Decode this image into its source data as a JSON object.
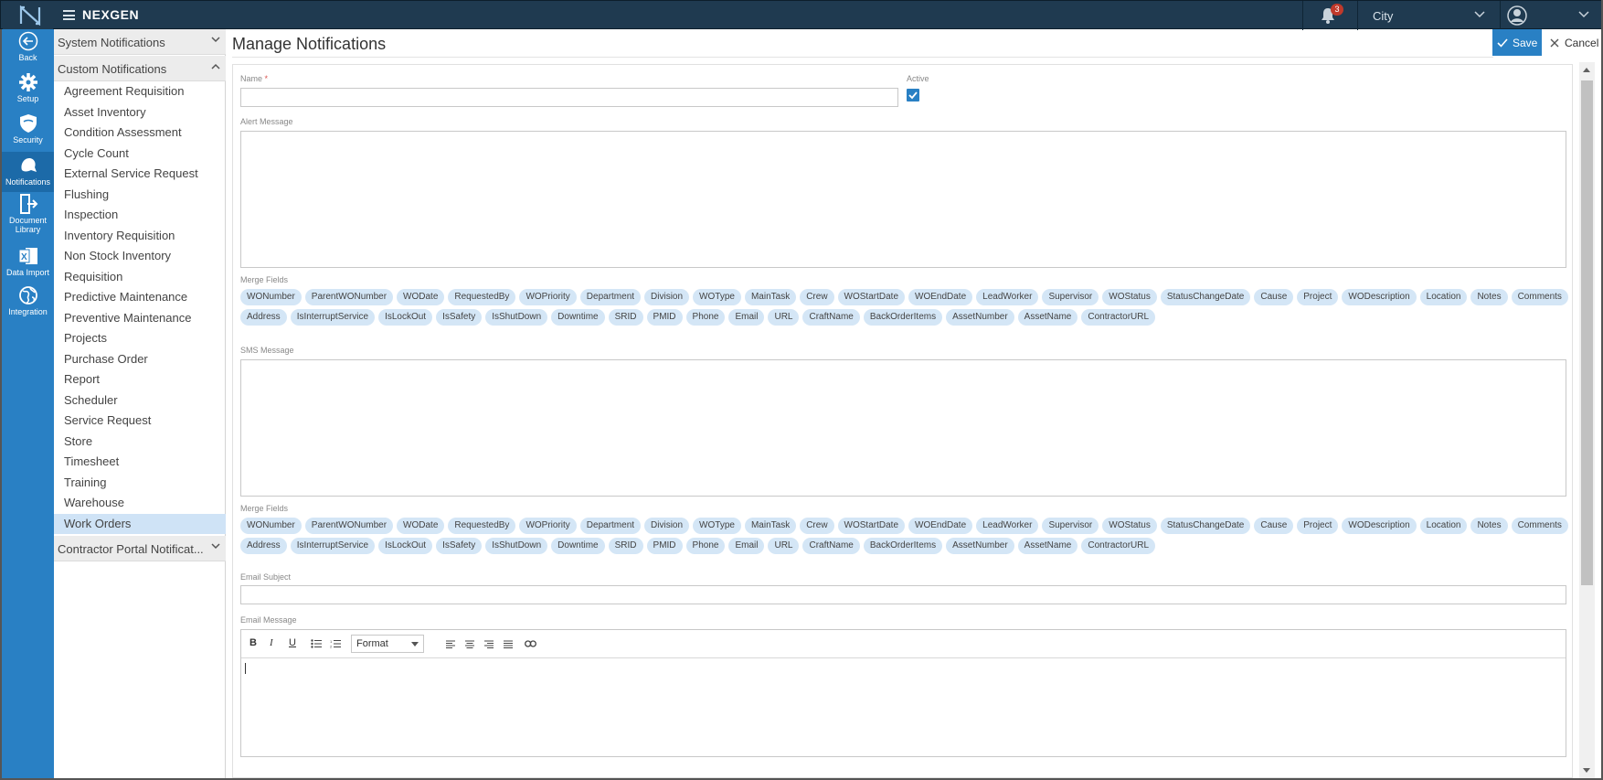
{
  "app": {
    "brand": "NEXGEN",
    "notification_count": "3",
    "site_selector": "City"
  },
  "rail": [
    {
      "label": "Back",
      "icon": "back-arrow-icon"
    },
    {
      "label": "Setup",
      "icon": "gear-icon"
    },
    {
      "label": "Security",
      "icon": "shield-icon"
    },
    {
      "label": "Notifications",
      "icon": "notifications-icon"
    },
    {
      "label": "Document",
      "label2": "Library",
      "icon": "document-library-icon"
    },
    {
      "label": "Data Import",
      "icon": "excel-icon"
    },
    {
      "label": "Integration",
      "icon": "globe-icon"
    }
  ],
  "tree": {
    "system_group": "System Notifications",
    "custom_group": "Custom Notifications",
    "contractor_group": "Contractor Portal Notificat...",
    "items": [
      "Agreement Requisition",
      "Asset Inventory",
      "Condition Assessment",
      "Cycle Count",
      "External Service Request",
      "Flushing",
      "Inspection",
      "Inventory Requisition",
      "Non Stock Inventory",
      "Requisition",
      "Predictive Maintenance",
      "Preventive Maintenance",
      "Projects",
      "Purchase Order",
      "Report",
      "Scheduler",
      "Service Request",
      "Store",
      "Timesheet",
      "Training",
      "Warehouse",
      "Work Orders"
    ]
  },
  "page": {
    "title": "Manage Notifications",
    "save": "Save",
    "cancel": "Cancel"
  },
  "form": {
    "name_label": "Name",
    "required_mark": "*",
    "active_label": "Active",
    "active_checked": true,
    "alert_label": "Alert Message",
    "merge_label": "Merge Fields",
    "sms_label": "SMS Message",
    "email_subject_label": "Email Subject",
    "email_message_label": "Email Message",
    "merge_fields": [
      "WONumber",
      "ParentWONumber",
      "WODate",
      "RequestedBy",
      "WOPriority",
      "Department",
      "Division",
      "WOType",
      "MainTask",
      "Crew",
      "WOStartDate",
      "WOEndDate",
      "LeadWorker",
      "Supervisor",
      "WOStatus",
      "StatusChangeDate",
      "Cause",
      "Project",
      "WODescription",
      "Location",
      "Notes",
      "Comments",
      "Address",
      "IsInterruptService",
      "IsLockOut",
      "IsSafety",
      "IsShutDown",
      "Downtime",
      "SRID",
      "PMID",
      "Phone",
      "Email",
      "URL",
      "CraftName",
      "BackOrderItems",
      "AssetNumber",
      "AssetName",
      "ContractorURL"
    ]
  },
  "editor": {
    "bold": "B",
    "italic": "I",
    "underline": "U",
    "format": "Format"
  },
  "colors": {
    "topbar": "#1f3a50",
    "rail": "#2980c4",
    "chip": "#d4e6f6",
    "selected": "#cfe3f6"
  }
}
